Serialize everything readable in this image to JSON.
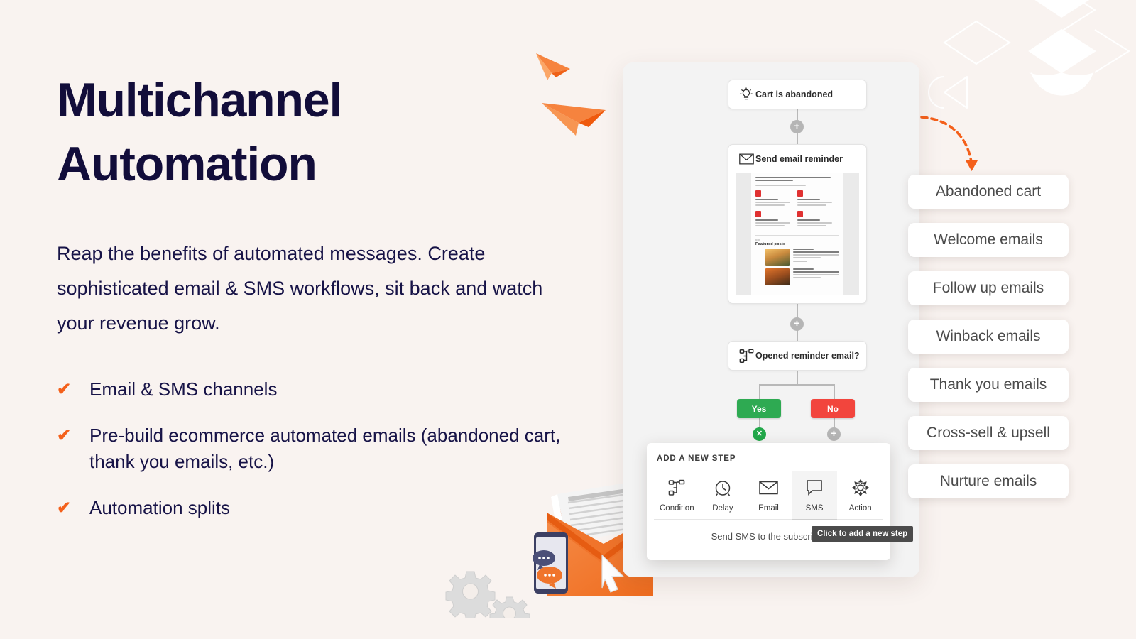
{
  "colors": {
    "background": "#f9f3f0",
    "heading": "#120d3a",
    "accent_orange": "#f4601b",
    "panel_gray": "#f3f3f3",
    "yes_green": "#2eaa52",
    "no_red": "#f2453d",
    "tooltip_dark": "#4b4b4b"
  },
  "hero": {
    "title_line1": "Multichannel",
    "title_line2": "Automation",
    "paragraph": "Reap the benefits of automated messages. Create sophisticated email & SMS workflows, sit back and watch your revenue grow.",
    "features": [
      {
        "check": "✔",
        "text": "Email & SMS channels"
      },
      {
        "check": "✔",
        "text": "Pre-build ecommerce automated emails (abandoned cart, thank you emails, etc.)"
      },
      {
        "check": "✔",
        "text": "Automation splits"
      }
    ]
  },
  "builder": {
    "trigger_node": {
      "icon": "lightbulb-icon",
      "label": "Cart is abandoned"
    },
    "email_node": {
      "icon": "envelope-icon",
      "label": "Send email reminder"
    },
    "email_preview": {
      "featured_heading": "Featured posts",
      "eyebrow": "Blog"
    },
    "condition_node": {
      "icon": "condition-split-icon",
      "label": "Opened reminder email?"
    },
    "branches": {
      "yes_label": "Yes",
      "no_label": "No"
    },
    "plus_label": "+",
    "close_label": "✕"
  },
  "add_step": {
    "title": "ADD A NEW STEP",
    "options": [
      {
        "icon": "condition-split-icon",
        "label": "Condition",
        "active": false
      },
      {
        "icon": "clock-icon",
        "label": "Delay",
        "active": false
      },
      {
        "icon": "envelope-icon",
        "label": "Email",
        "active": false
      },
      {
        "icon": "chat-bubble-icon",
        "label": "SMS",
        "active": true
      },
      {
        "icon": "gear-icon",
        "label": "Action",
        "active": false
      }
    ],
    "hint": "Send SMS to the subscriber",
    "tooltip": "Click to add a new step"
  },
  "pills": [
    {
      "label": "Abandoned cart"
    },
    {
      "label": "Welcome emails"
    },
    {
      "label": "Follow up emails"
    },
    {
      "label": "Winback emails"
    },
    {
      "label": "Thank you emails"
    },
    {
      "label": "Cross-sell & upsell"
    },
    {
      "label": "Nurture emails"
    }
  ]
}
